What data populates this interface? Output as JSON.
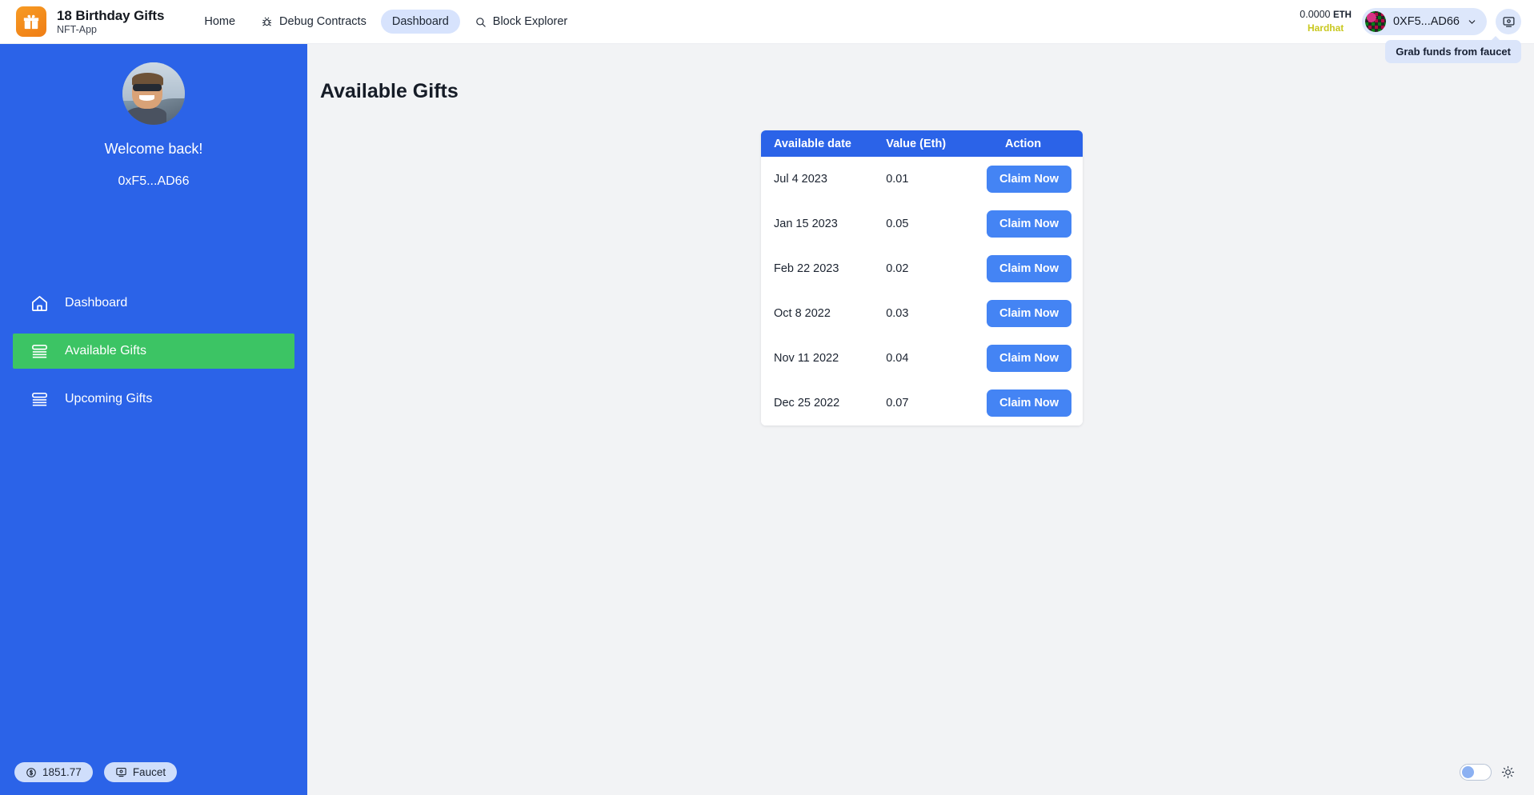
{
  "header": {
    "brand": {
      "title": "18 Birthday Gifts",
      "subtitle": "NFT-App",
      "logo_icon": "gift-icon"
    },
    "nav": [
      {
        "label": "Home",
        "icon": null,
        "active": false
      },
      {
        "label": "Debug Contracts",
        "icon": "bug-icon",
        "active": false
      },
      {
        "label": "Dashboard",
        "icon": null,
        "active": true
      },
      {
        "label": "Block Explorer",
        "icon": "search-icon",
        "active": false
      }
    ],
    "balance": {
      "amount": "0.0000",
      "currency": "ETH",
      "network": "Hardhat"
    },
    "wallet": {
      "address": "0XF5...AD66",
      "chevron": "chevron-down-icon",
      "avatar": "blockie-avatar"
    },
    "faucet_button": {
      "icon": "monitor-faucet-icon"
    },
    "tooltip": "Grab funds from faucet"
  },
  "sidebar": {
    "welcome": "Welcome back!",
    "wallet_short": "0xF5...AD66",
    "avatar": "user-photo-avatar",
    "items": [
      {
        "label": "Dashboard",
        "icon": "home-icon",
        "active": false
      },
      {
        "label": "Available Gifts",
        "icon": "list-stack-icon",
        "active": true
      },
      {
        "label": "Upcoming Gifts",
        "icon": "list-stack-icon",
        "active": false
      }
    ],
    "footer": {
      "price": {
        "value": "1851.77",
        "icon": "dollar-circle-icon"
      },
      "faucet": {
        "label": "Faucet",
        "icon": "monitor-faucet-icon"
      }
    }
  },
  "main": {
    "page_title": "Available Gifts",
    "table": {
      "columns": [
        "Available date",
        "Value (Eth)",
        "Action"
      ],
      "rows": [
        {
          "date": "Jul 4 2023",
          "value": "0.01",
          "action": "Claim Now"
        },
        {
          "date": "Jan 15 2023",
          "value": "0.05",
          "action": "Claim Now"
        },
        {
          "date": "Feb 22 2023",
          "value": "0.02",
          "action": "Claim Now"
        },
        {
          "date": "Oct 8 2022",
          "value": "0.03",
          "action": "Claim Now"
        },
        {
          "date": "Nov 11 2022",
          "value": "0.04",
          "action": "Claim Now"
        },
        {
          "date": "Dec 25 2022",
          "value": "0.07",
          "action": "Claim Now"
        }
      ]
    },
    "theme_toggle": {
      "state": "light",
      "icon": "sun-icon"
    }
  },
  "colors": {
    "sidebar_blue": "#2b63e8",
    "active_green": "#3cc464",
    "accent_blue": "#4484f4",
    "brand_orange": "#ef7d15",
    "network_yellow": "#c9c81f",
    "page_bg": "#f2f3f5"
  }
}
